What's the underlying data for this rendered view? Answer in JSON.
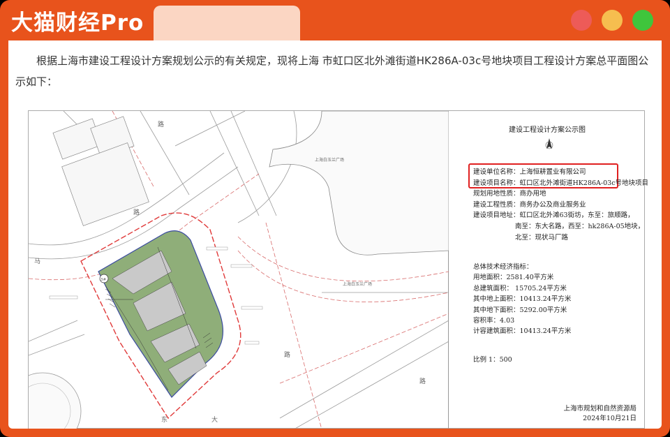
{
  "brand": {
    "name": "大猫财经Pro"
  },
  "window_controls": {
    "close_color": "#ed5b58",
    "minimize_color": "#f6be4f",
    "zoom_color": "#3fc53c"
  },
  "article": {
    "intro": "根据上海市建设工程设计方案规划公示的有关规定，现将上海 市虹口区北外滩街道HK286A-03c号地块项目工程设计方案总平面图公示如下："
  },
  "plan": {
    "labels": {
      "plaza_1": "上海白玉兰广场",
      "plaza_2": "上海白玉兰广场",
      "road_glyph_1": "路",
      "road_glyph_2": "路",
      "road_glyph_3": "路",
      "road_glyph_4": "路",
      "road_glyph_5": "马",
      "road_glyph_6": "东",
      "road_glyph_7": "大",
      "site_badge": "3#"
    }
  },
  "legend": {
    "title": "建设工程设计方案公示图",
    "unit_label": "建设单位名称：",
    "unit_value": "上海恒耕置业有限公司",
    "project_label": "建设项目名称：",
    "project_value": "虹口区北外滩街道HK286A-03c号地块项目",
    "land_use_label": "规划用地性质：",
    "land_use_value": "商办用地",
    "nature_label": "建设工程性质：",
    "nature_value": "商务办公及商业服务业",
    "address_label": "建设项目地址：",
    "address_line1": "虹口区北外滩63街坊，东至：旅顺路，",
    "address_line2": "南至：东大名路，西至：hk286A-05地块，",
    "address_line3": "北至：现状马厂路",
    "stats_title": "总体技术经济指标：",
    "stats": [
      "用地面积：2581.40平方米",
      "总建筑面积：  15705.24平方米",
      "其中地上面积：10413.24平方米",
      "其中地下面积：5292.00平方米",
      "容积率：4.03",
      "计容建筑面积：10413.24平方米"
    ],
    "scale": "比例   1：500",
    "agency": "上海市规划和自然资源局",
    "date": "2024年10月21日"
  }
}
